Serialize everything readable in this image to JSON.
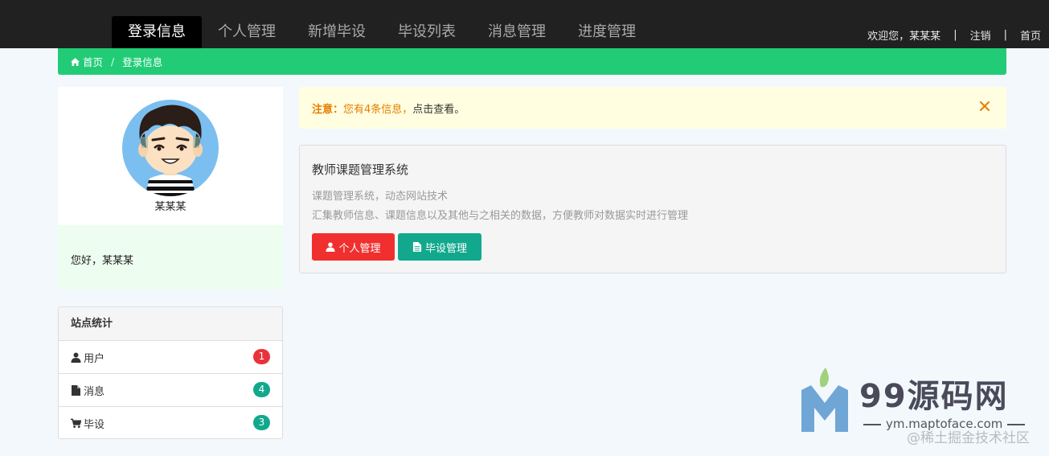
{
  "nav": {
    "items": [
      {
        "label": "登录信息",
        "active": true
      },
      {
        "label": "个人管理",
        "active": false
      },
      {
        "label": "新增毕设",
        "active": false
      },
      {
        "label": "毕设列表",
        "active": false
      },
      {
        "label": "消息管理",
        "active": false
      },
      {
        "label": "进度管理",
        "active": false
      }
    ],
    "welcome": "欢迎您，某某某",
    "logout": "注销",
    "home": "首页"
  },
  "breadcrumb": {
    "home": "首页",
    "separator": "/",
    "current": "登录信息"
  },
  "profile": {
    "name": "某某某",
    "greeting": "您好，某某某"
  },
  "stats": {
    "title": "站点统计",
    "rows": [
      {
        "label": "用户",
        "icon": "user-icon",
        "count": "1",
        "color": "#e8333a"
      },
      {
        "label": "消息",
        "icon": "file-icon",
        "count": "4",
        "color": "#12a88d"
      },
      {
        "label": "毕设",
        "icon": "cart-icon",
        "count": "3",
        "color": "#12a88d"
      }
    ]
  },
  "alert": {
    "strong": "注意：",
    "warn": "您有4条信息，",
    "rest": "点击查看。"
  },
  "jumbotron": {
    "title": "教师课题管理系统",
    "line1": "课题管理系统，动态网站技术",
    "line2": "汇集教师信息、课题信息以及其他与之相关的数据，方便教师对数据实时进行管理",
    "btn_personal": "个人管理",
    "btn_project": "毕设管理"
  },
  "watermark": {
    "brand": "99源码网",
    "url": "ym.maptoface.com",
    "site": "@稀土掘金技术社区"
  },
  "colors": {
    "nav_bg": "#212121",
    "accent_green": "#22cc77",
    "btn_red": "#f0302e",
    "btn_teal": "#12a88d",
    "alert_bg": "#fffee0"
  }
}
